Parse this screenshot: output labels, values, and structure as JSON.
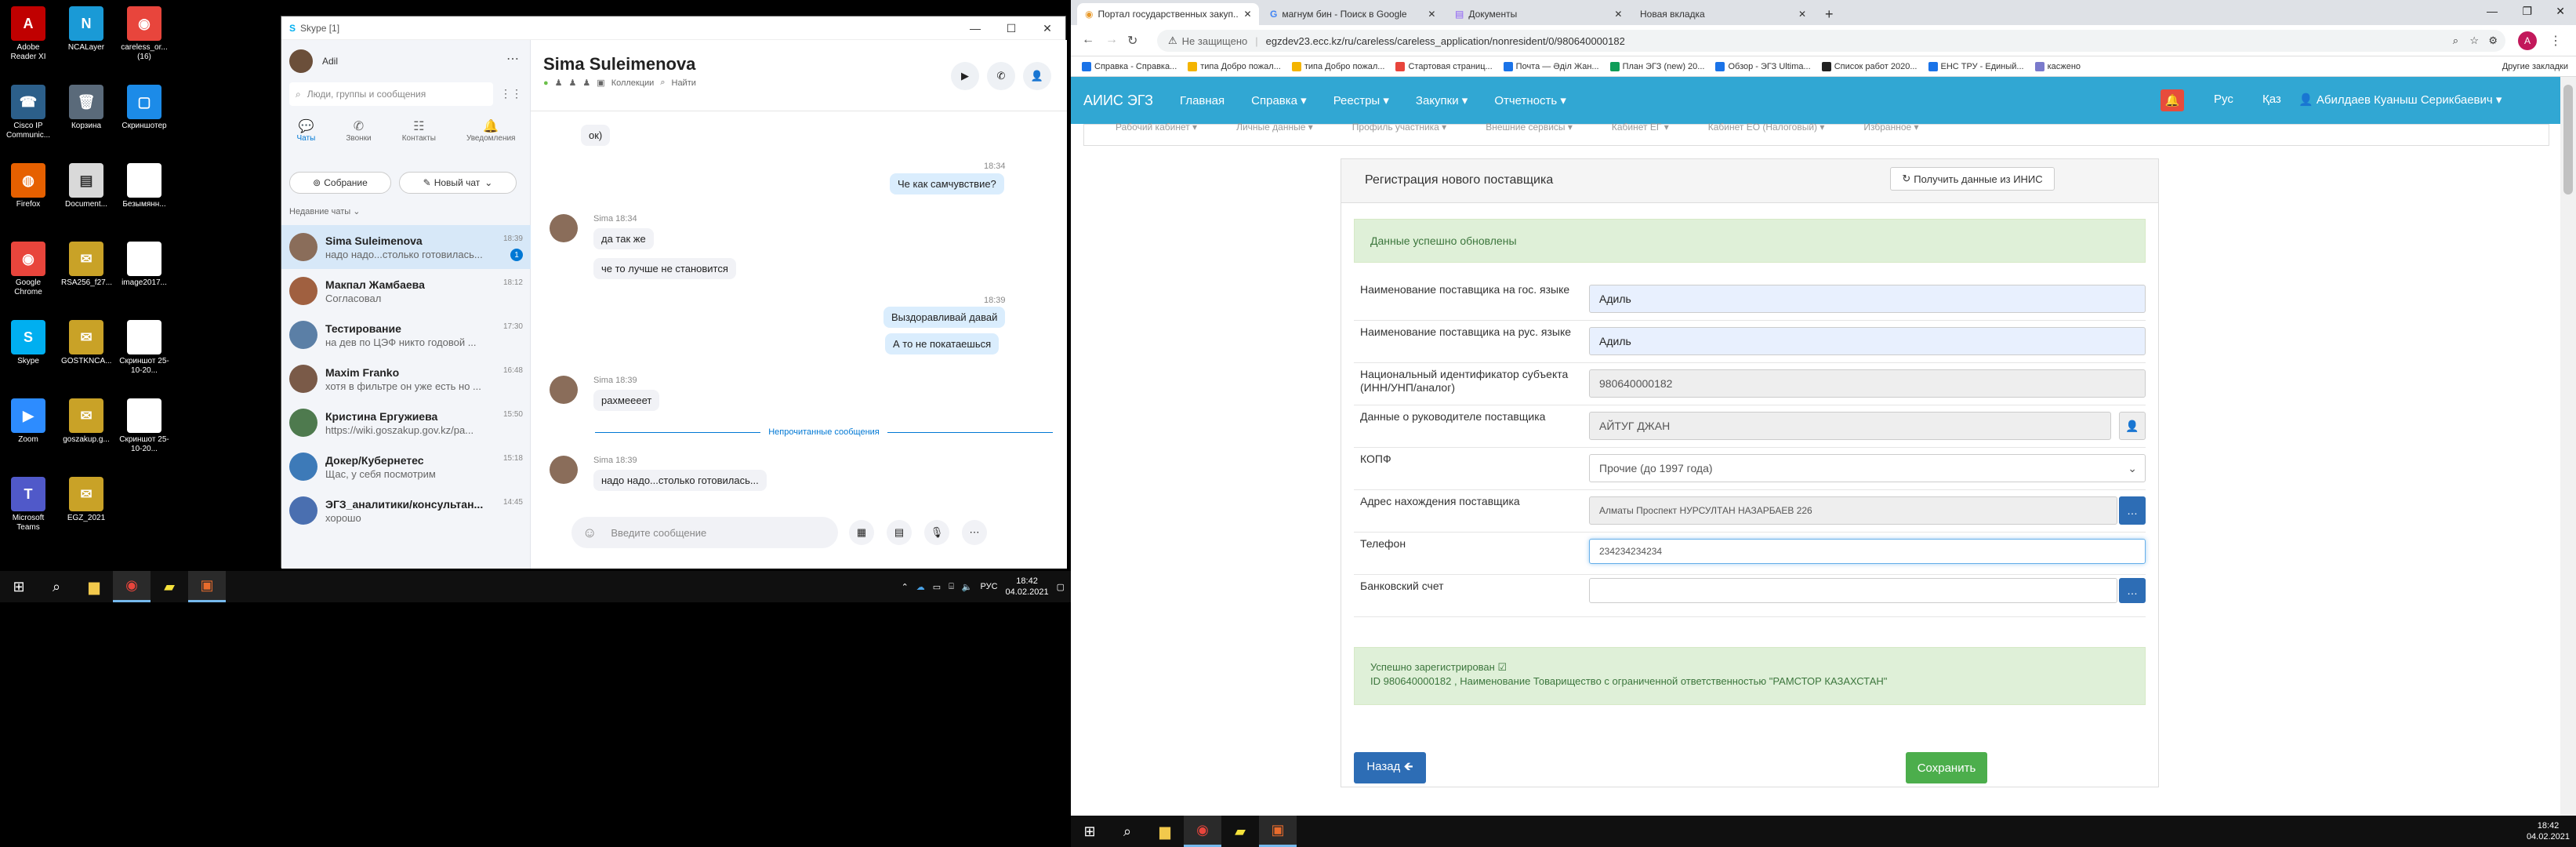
{
  "desktop_icons": [
    {
      "label": "Adobe Reader XI",
      "color": "#c00000",
      "glyph": "A"
    },
    {
      "label": "NCALayer",
      "color": "#1a9ad6",
      "glyph": "N"
    },
    {
      "label": "careless_or... (16)",
      "color": "#e8453c",
      "glyph": "◉"
    },
    {
      "label": "Cisco IP Communic...",
      "color": "#2c5f8a",
      "glyph": "☎"
    },
    {
      "label": "Корзина",
      "color": "#5a6a7a",
      "glyph": "🗑"
    },
    {
      "label": "Скриншотер",
      "color": "#1c8be8",
      "glyph": "▢"
    },
    {
      "label": "Firefox",
      "color": "#e66000",
      "glyph": "◍"
    },
    {
      "label": "Document...",
      "color": "#d9d9d9",
      "glyph": "▤"
    },
    {
      "label": "Безымянн...",
      "color": "#ffffff",
      "glyph": ""
    },
    {
      "label": "Google Chrome",
      "color": "#e8453c",
      "glyph": "◉"
    },
    {
      "label": "RSA256_f27...",
      "color": "#c9a227",
      "glyph": "✉"
    },
    {
      "label": "image2017...",
      "color": "#ffffff",
      "glyph": ""
    },
    {
      "label": "Skype",
      "color": "#00aff0",
      "glyph": "S"
    },
    {
      "label": "GOSTKNCA...",
      "color": "#c9a227",
      "glyph": "✉"
    },
    {
      "label": "Скриншот 25-10-20...",
      "color": "#ffffff",
      "glyph": ""
    },
    {
      "label": "Zoom",
      "color": "#2d8cff",
      "glyph": "▶"
    },
    {
      "label": "goszakup.g...",
      "color": "#c9a227",
      "glyph": "✉"
    },
    {
      "label": "Скриншот 25-10-20...",
      "color": "#ffffff",
      "glyph": ""
    },
    {
      "label": "Microsoft Teams",
      "color": "#5059c9",
      "glyph": "T"
    },
    {
      "label": "EGZ_2021",
      "color": "#c9a227",
      "glyph": "✉"
    }
  ],
  "taskbar_left": {
    "time": "18:42",
    "date": "04.02.2021",
    "lang": "РУС"
  },
  "taskbar_right": {
    "time": "18:42",
    "date": "04.02.2021"
  },
  "skype": {
    "window_title": "Skype [1]",
    "user_name": "Adil",
    "search_placeholder": "Люди, группы и сообщения",
    "nav": [
      "Чаты",
      "Звонки",
      "Контакты",
      "Уведомления"
    ],
    "meeting_btn": "Собрание",
    "new_chat_btn": "Новый чат",
    "recent_label": "Недавние чаты",
    "chats": [
      {
        "name": "Sima Suleimenova",
        "preview": "надо надо...столько готовилась...",
        "time": "18:39",
        "badge": "1"
      },
      {
        "name": "Макпал Жамбаева",
        "preview": "Согласовал",
        "time": "18:12",
        "badge": ""
      },
      {
        "name": "Тестирование",
        "preview": "на дев по ЦЭФ никто годовой ...",
        "time": "17:30",
        "badge": ""
      },
      {
        "name": "Maxim Franko",
        "preview": "хотя в фильтре он уже есть но ...",
        "time": "16:48",
        "badge": ""
      },
      {
        "name": "Кристина Ергужиева",
        "preview": "https://wiki.goszakup.gov.kz/pa...",
        "time": "15:50",
        "badge": ""
      },
      {
        "name": "Докер/Кубернетес",
        "preview": "Щас, у себя посмотрим",
        "time": "15:18",
        "badge": ""
      },
      {
        "name": "ЭГЗ_аналитики/консультан...",
        "preview": "хорошо",
        "time": "14:45",
        "badge": ""
      }
    ],
    "conv_title": "Sima Suleimenova",
    "conv_sub_collection": "Коллекции",
    "conv_sub_find": "Найти",
    "messages": [
      {
        "dir": "in",
        "text": "ок)",
        "meta": ""
      },
      {
        "dir": "out",
        "text": "Че как самчувствие?",
        "meta": "18:34"
      },
      {
        "dir": "in",
        "text": "да так же",
        "meta": "Sima 18:34"
      },
      {
        "dir": "in",
        "text": "че то лучше не становится",
        "meta": ""
      },
      {
        "dir": "out",
        "text": "Выздоравливай давай",
        "meta": "18:39"
      },
      {
        "dir": "out",
        "text": "А то не покатаешься",
        "meta": ""
      },
      {
        "dir": "in",
        "text": "рахмеееет",
        "meta": "Sima 18:39"
      },
      {
        "dir": "in",
        "text": "надо надо...столько готовилась...",
        "meta": "Sima 18:39"
      }
    ],
    "unread_divider": "Непрочитанные сообщения",
    "compose_placeholder": "Введите сообщение"
  },
  "chrome": {
    "tabs": [
      "Портал государственных закуп...",
      "магнум бин - Поиск в Google",
      "Документы",
      "Новая вкладка"
    ],
    "insecure_label": "Не защищено",
    "url": "egzdev23.ecc.kz/ru/careless/careless_application/nonresident/0/980640000182",
    "bookmarks": [
      "Справка - Справка...",
      "типа Добро пожал...",
      "типа Добро пожал...",
      "Стартовая страниц...",
      "Почта — Әділ Жан...",
      "План ЭГЗ (new) 20...",
      "Обзор - ЭГЗ Ultima...",
      "Список работ 2020...",
      "ЕНС ТРУ - Единый...",
      "касжено"
    ],
    "other_bookmarks": "Другие закладки"
  },
  "site": {
    "brand": "АИИС ЭГЗ",
    "menu": [
      "Главная",
      "Справка ▾",
      "Реестры ▾",
      "Закупки ▾",
      "Отчетность ▾"
    ],
    "lang_ru": "Рус",
    "lang_kz": "Қаз",
    "user": "Абилдаев Куаныш Серикбаевич ▾",
    "submenu": [
      "Рабочий кабинет ▾",
      "Личные данные ▾",
      "Профиль участника ▾",
      "Внешние сервисы ▾",
      "Кабинет ЕГ ▾",
      "Кабинет ЕО (Налоговый) ▾",
      "Избранное ▾"
    ],
    "panel_title": "Регистрация нового поставщика",
    "fetch_btn": "Получить данные из ИНИС",
    "alert_updated": "Данные успешно обновлены",
    "fields": [
      {
        "label": "Наименование поставщика на гос. языке",
        "value": "Адиль"
      },
      {
        "label": "Наименование поставщика на рус. языке",
        "value": "Адиль"
      },
      {
        "label": "Национальный идентификатор субъекта (ИНН/УНП/аналог)",
        "value": "980640000182"
      },
      {
        "label": "Данные о руководителе поставщика",
        "value": "АЙТУГ ДЖАН"
      },
      {
        "label": "КОПФ",
        "value": "Прочие (до 1997 года)"
      },
      {
        "label": "Адрес нахождения поставщика",
        "value": "Алматы Проспект НУРСУЛТАН НАЗАРБАЕВ 226"
      },
      {
        "label": "Телефон",
        "value": "234234234234"
      },
      {
        "label": "Банковский счет",
        "value": ""
      }
    ],
    "success_title": "Успешно зарегистрирован ☑",
    "success_text": "ID 980640000182 , Наименование Товарищество с ограниченной ответственностью \"РАМСТОР КАЗАХСТАН\"",
    "back_btn": "Назад 🡸",
    "save_btn": "Сохранить"
  }
}
